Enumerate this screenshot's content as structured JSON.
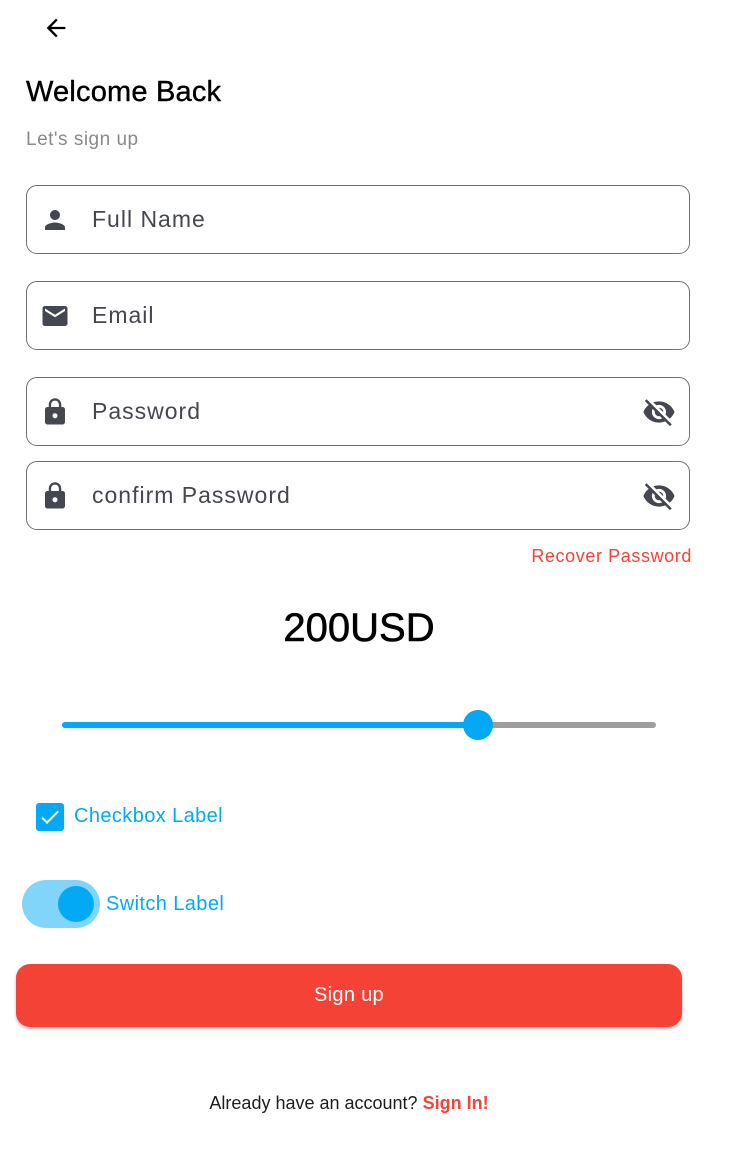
{
  "header": {
    "back_icon": "arrow-left-icon",
    "title": "Welcome Back",
    "subtitle": "Let's sign up"
  },
  "form": {
    "full_name": {
      "placeholder": "Full Name",
      "value": "",
      "icon": "person-icon"
    },
    "email": {
      "placeholder": "Email",
      "value": "",
      "icon": "mail-icon"
    },
    "password": {
      "placeholder": "Password",
      "value": "",
      "icon": "lock-icon",
      "toggle_icon": "visibility-off-icon"
    },
    "confirm_password": {
      "placeholder": "confirm Password",
      "value": "",
      "icon": "lock-icon",
      "toggle_icon": "visibility-off-icon"
    },
    "recover_link": "Recover Password"
  },
  "amount": {
    "display": "200USD",
    "slider_fraction": 0.7
  },
  "checkbox": {
    "label": "Checkbox Label",
    "checked": true
  },
  "switch": {
    "label": "Switch Label",
    "on": true
  },
  "signup_button": "Sign up",
  "footer": {
    "prompt": "Already have an account?",
    "link": "Sign In!"
  },
  "colors": {
    "accent": "#f44336",
    "primary": "#03a9f4",
    "primary_light": "#81d4fa",
    "icon": "#444650",
    "border": "#6f6f6f"
  }
}
